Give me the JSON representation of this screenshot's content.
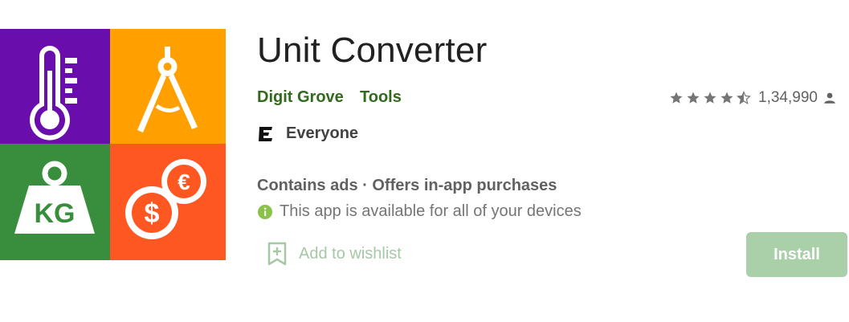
{
  "app": {
    "title": "Unit Converter",
    "developer": "Digit Grove",
    "category": "Tools",
    "rating_count": "1,34,990",
    "rating_value": 4.5,
    "content_rating": "Everyone",
    "ads_info": "Contains ads · Offers in-app purchases",
    "availability": "This app is available for all of your devices",
    "wishlist_label": "Add to wishlist",
    "install_label": "Install"
  },
  "icon": {
    "tiles": [
      {
        "name": "thermometer-icon",
        "color": "#6a0dad"
      },
      {
        "name": "compass-icon",
        "color": "#ffa000"
      },
      {
        "name": "weight-kg-icon",
        "color": "#388e3c",
        "text": "KG"
      },
      {
        "name": "currency-icon",
        "color": "#ff5722",
        "text_a": "$",
        "text_b": "€"
      }
    ]
  },
  "colors": {
    "accent": "#33691e",
    "install_bg": "#a9d0a9",
    "star": "#757575"
  }
}
